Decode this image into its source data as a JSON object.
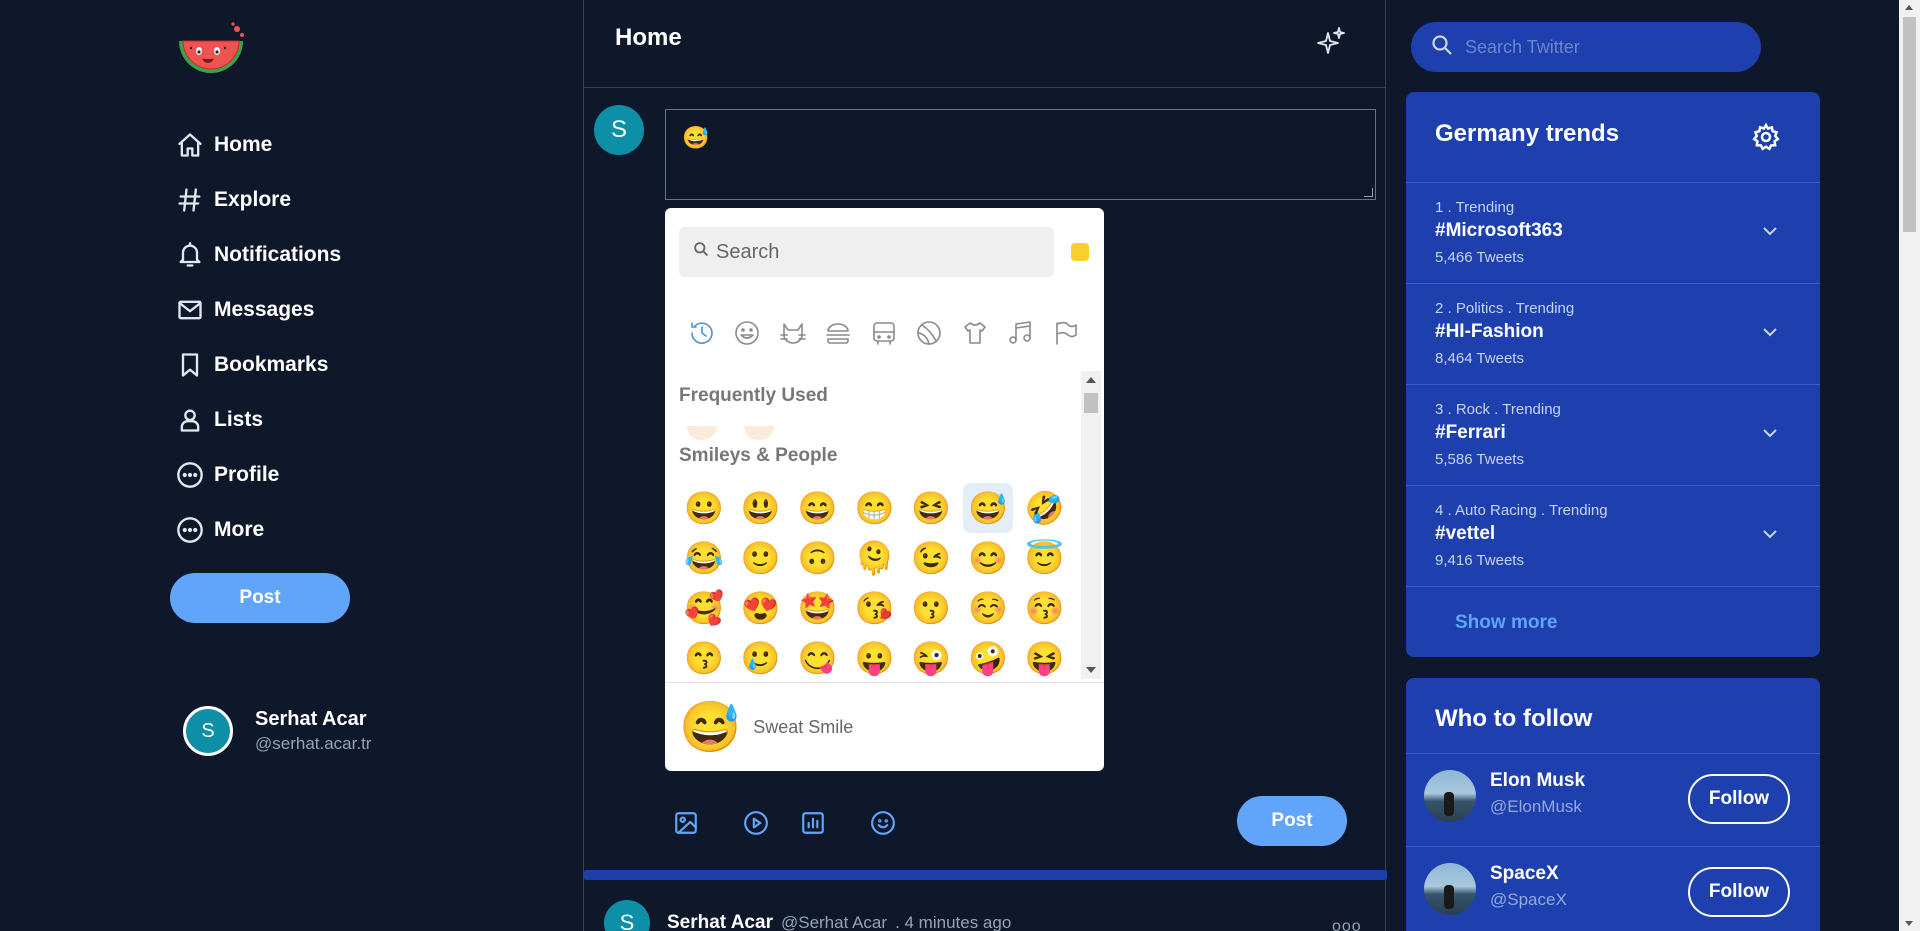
{
  "nav": {
    "items": [
      {
        "label": "Home",
        "icon": "home-icon"
      },
      {
        "label": "Explore",
        "icon": "hashtag-icon"
      },
      {
        "label": "Notifications",
        "icon": "bell-icon"
      },
      {
        "label": "Messages",
        "icon": "mail-icon"
      },
      {
        "label": "Bookmarks",
        "icon": "bookmark-icon"
      },
      {
        "label": "Lists",
        "icon": "user-icon"
      },
      {
        "label": "Profile",
        "icon": "dots-circle-icon"
      },
      {
        "label": "More",
        "icon": "dots-circle-icon"
      }
    ],
    "post_label": "Post"
  },
  "user": {
    "initial": "S",
    "name": "Serhat Acar",
    "handle": "@serhat.acar.tr"
  },
  "center": {
    "title": "Home",
    "compose": {
      "initial": "S",
      "value": "😅"
    },
    "post_label": "Post",
    "tweet": {
      "initial": "S",
      "name": "Serhat Acar",
      "handle": "@Serhat Acar",
      "time": ". 4 minutes ago",
      "more": "ooo"
    }
  },
  "picker": {
    "search_placeholder": "Search",
    "skin_color": "#fbcf2c",
    "frequent_label": "Frequently Used",
    "smileys_label": "Smileys & People",
    "emojis": [
      "😀",
      "😃",
      "😄",
      "😁",
      "😆",
      "😅",
      "🤣",
      "😂",
      "🙂",
      "🙃",
      "🫠",
      "😉",
      "😊",
      "😇",
      "🥰",
      "😍",
      "🤩",
      "😘",
      "😗",
      "☺️",
      "😚",
      "😙",
      "🥲",
      "😋",
      "😛",
      "😜",
      "🤪",
      "😝"
    ],
    "selected_index": 5,
    "preview_emoji": "😅",
    "preview_name": "Sweat Smile"
  },
  "right": {
    "search_placeholder": "Search Twitter",
    "trends_title": "Germany trends",
    "trends": [
      {
        "meta": "1 . Trending",
        "tag": "#Microsoft363",
        "count": "5,466 Tweets"
      },
      {
        "meta": "2 . Politics . Trending",
        "tag": "#HI-Fashion",
        "count": "8,464 Tweets"
      },
      {
        "meta": "3 . Rock . Trending",
        "tag": "#Ferrari",
        "count": "5,586 Tweets"
      },
      {
        "meta": "4 . Auto Racing . Trending",
        "tag": "#vettel",
        "count": "9,416 Tweets"
      }
    ],
    "show_more": "Show more",
    "follow_title": "Who to follow",
    "follow": [
      {
        "name": "Elon Musk",
        "handle": "@ElonMusk",
        "button": "Follow"
      },
      {
        "name": "SpaceX",
        "handle": "@SpaceX",
        "button": "Follow"
      }
    ]
  },
  "colors": {
    "background": "#0f172a",
    "accent": "#60a5fa",
    "panel": "#1e40af"
  }
}
